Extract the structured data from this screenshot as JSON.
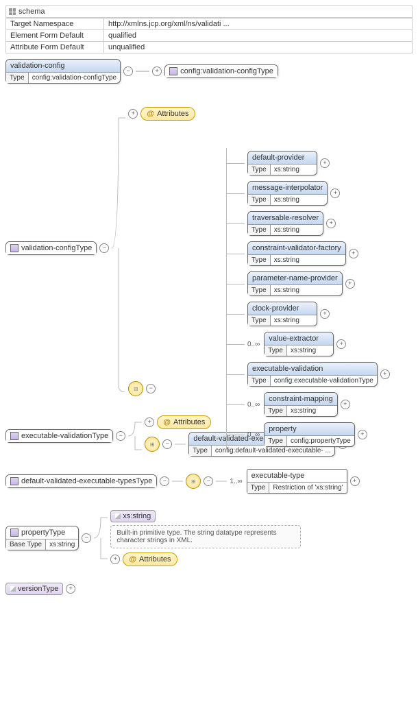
{
  "header": {
    "title": "schema",
    "rows": [
      [
        "Target Namespace",
        "http://xmlns.jcp.org/xml/ns/validati ..."
      ],
      [
        "Element Form Default",
        "qualified"
      ],
      [
        "Attribute Form Default",
        "unqualified"
      ]
    ]
  },
  "root": {
    "name": "validation-config",
    "typeLabel": "Type",
    "type": "config:validation-configType",
    "target": "config:validation-configType"
  },
  "vct": {
    "name": "validation-configType",
    "attributes": "Attributes",
    "children": [
      {
        "name": "default-provider",
        "type": "xs:string"
      },
      {
        "name": "message-interpolator",
        "type": "xs:string"
      },
      {
        "name": "traversable-resolver",
        "type": "xs:string"
      },
      {
        "name": "constraint-validator-factory",
        "type": "xs:string"
      },
      {
        "name": "parameter-name-provider",
        "type": "xs:string"
      },
      {
        "name": "clock-provider",
        "type": "xs:string"
      },
      {
        "name": "value-extractor",
        "type": "xs:string",
        "occ": "0..∞"
      },
      {
        "name": "executable-validation",
        "type": "config:executable-validationType"
      },
      {
        "name": "constraint-mapping",
        "type": "xs:string",
        "occ": "0..∞"
      },
      {
        "name": "property",
        "type": "config:propertyType",
        "occ": "0..∞"
      }
    ]
  },
  "evt": {
    "name": "executable-validationType",
    "attributes": "Attributes",
    "child": {
      "name": "default-validated-executable-types",
      "type": "config:default-validated-executable- ..."
    }
  },
  "dvet": {
    "name": "default-validated-executable-typesType",
    "occ": "1..∞",
    "child": {
      "name": "executable-type",
      "type": "Restriction of 'xs:string'"
    }
  },
  "pt": {
    "name": "propertyType",
    "baseLabel": "Base Type",
    "base": "xs:string",
    "simple": "xs:string",
    "doc": "Built-in primitive type. The string datatype represents character strings in XML.",
    "attributes": "Attributes"
  },
  "vt": {
    "name": "versionType"
  },
  "typeLabel": "Type"
}
